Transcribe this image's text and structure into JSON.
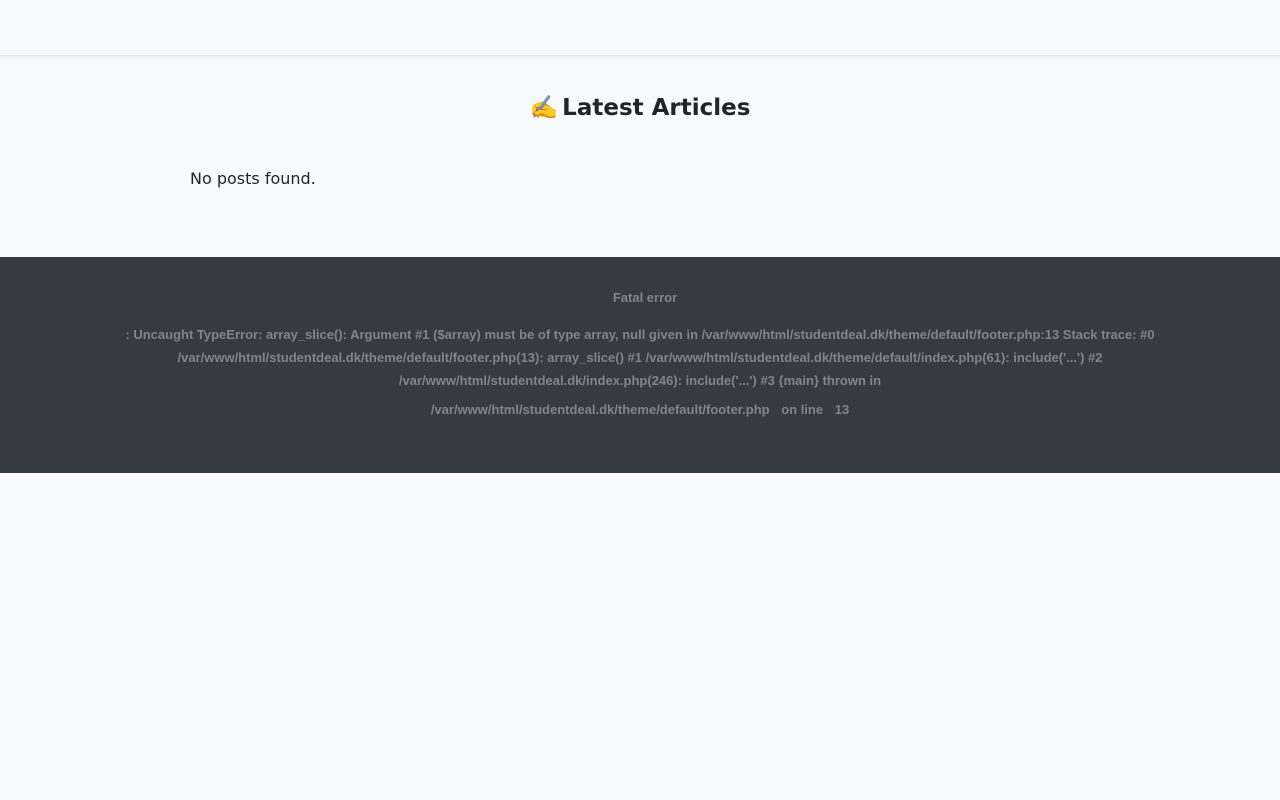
{
  "header": {},
  "main": {
    "title_emoji": "✍️",
    "title": "Latest Articles",
    "empty_message": "No posts found."
  },
  "footer": {
    "error_title": "Fatal error",
    "error_message": ": Uncaught TypeError: array_slice(): Argument #1 ($array) must be of type array, null given in /var/www/html/studentdeal.dk/theme/default/footer.php:13 Stack trace: #0 /var/www/html/studentdeal.dk/theme/default/footer.php(13): array_slice() #1 /var/www/html/studentdeal.dk/theme/default/index.php(61): include('...') #2 /var/www/html/studentdeal.dk/index.php(246): include('...') #3 {main} thrown in",
    "error_file": "/var/www/html/studentdeal.dk/theme/default/footer.php",
    "on_line_label": "on line",
    "error_line": "13"
  },
  "colors": {
    "page_background": "#f8f9fb",
    "footer_background": "#363a43",
    "footer_text": "#80848b",
    "heading_text": "#212529"
  }
}
